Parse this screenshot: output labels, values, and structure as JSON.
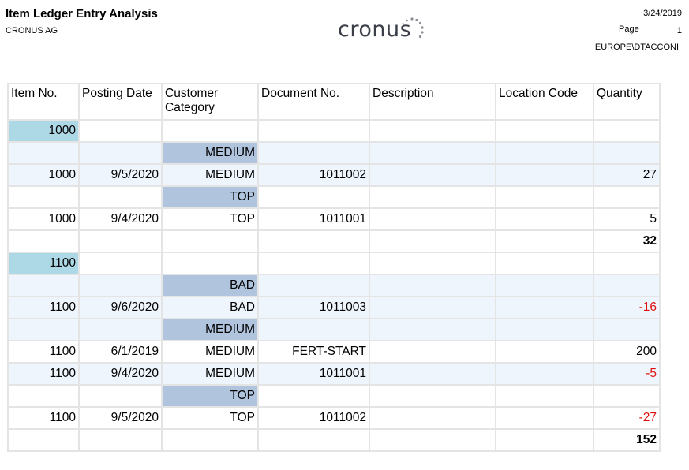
{
  "header": {
    "title": "Item Ledger Entry Analysis",
    "company": "CRONUS AG",
    "logo_text": "cronus",
    "date": "3/24/2019",
    "page_label": "Page",
    "page_number": "1",
    "user": "EUROPE\\DTACCONI"
  },
  "table": {
    "columns": [
      "Item No.",
      "Posting Date",
      "Customer Category",
      "Document No.",
      "Description",
      "Location Code",
      "Quantity"
    ],
    "groups": [
      {
        "item": "1000",
        "categories": [
          {
            "category": "MEDIUM",
            "rows": [
              {
                "item": "1000",
                "date": "9/5/2020",
                "category": "MEDIUM",
                "doc": "1011002",
                "description": "",
                "location": "",
                "qty": "27"
              }
            ]
          },
          {
            "category": "TOP",
            "rows": [
              {
                "item": "1000",
                "date": "9/4/2020",
                "category": "TOP",
                "doc": "1011001",
                "description": "",
                "location": "",
                "qty": "5"
              }
            ]
          }
        ],
        "total": "32"
      },
      {
        "item": "1100",
        "categories": [
          {
            "category": "BAD",
            "rows": [
              {
                "item": "1100",
                "date": "9/6/2020",
                "category": "BAD",
                "doc": "1011003",
                "description": "",
                "location": "",
                "qty": "-16"
              }
            ]
          },
          {
            "category": "MEDIUM",
            "rows": [
              {
                "item": "1100",
                "date": "6/1/2019",
                "category": "MEDIUM",
                "doc": "FERT-START",
                "description": "",
                "location": "",
                "qty": "200"
              },
              {
                "item": "1100",
                "date": "9/4/2020",
                "category": "MEDIUM",
                "doc": "1011001",
                "description": "",
                "location": "",
                "qty": "-5"
              }
            ]
          },
          {
            "category": "TOP",
            "rows": [
              {
                "item": "1100",
                "date": "9/5/2020",
                "category": "TOP",
                "doc": "1011002",
                "description": "",
                "location": "",
                "qty": "-27"
              }
            ]
          }
        ],
        "total": "152"
      }
    ]
  },
  "colors": {
    "item_header_bg": "#add8e6",
    "category_header_bg": "#b0c4de",
    "alt_row_bg": "#eef5fd",
    "negative_text": "#e01010"
  }
}
